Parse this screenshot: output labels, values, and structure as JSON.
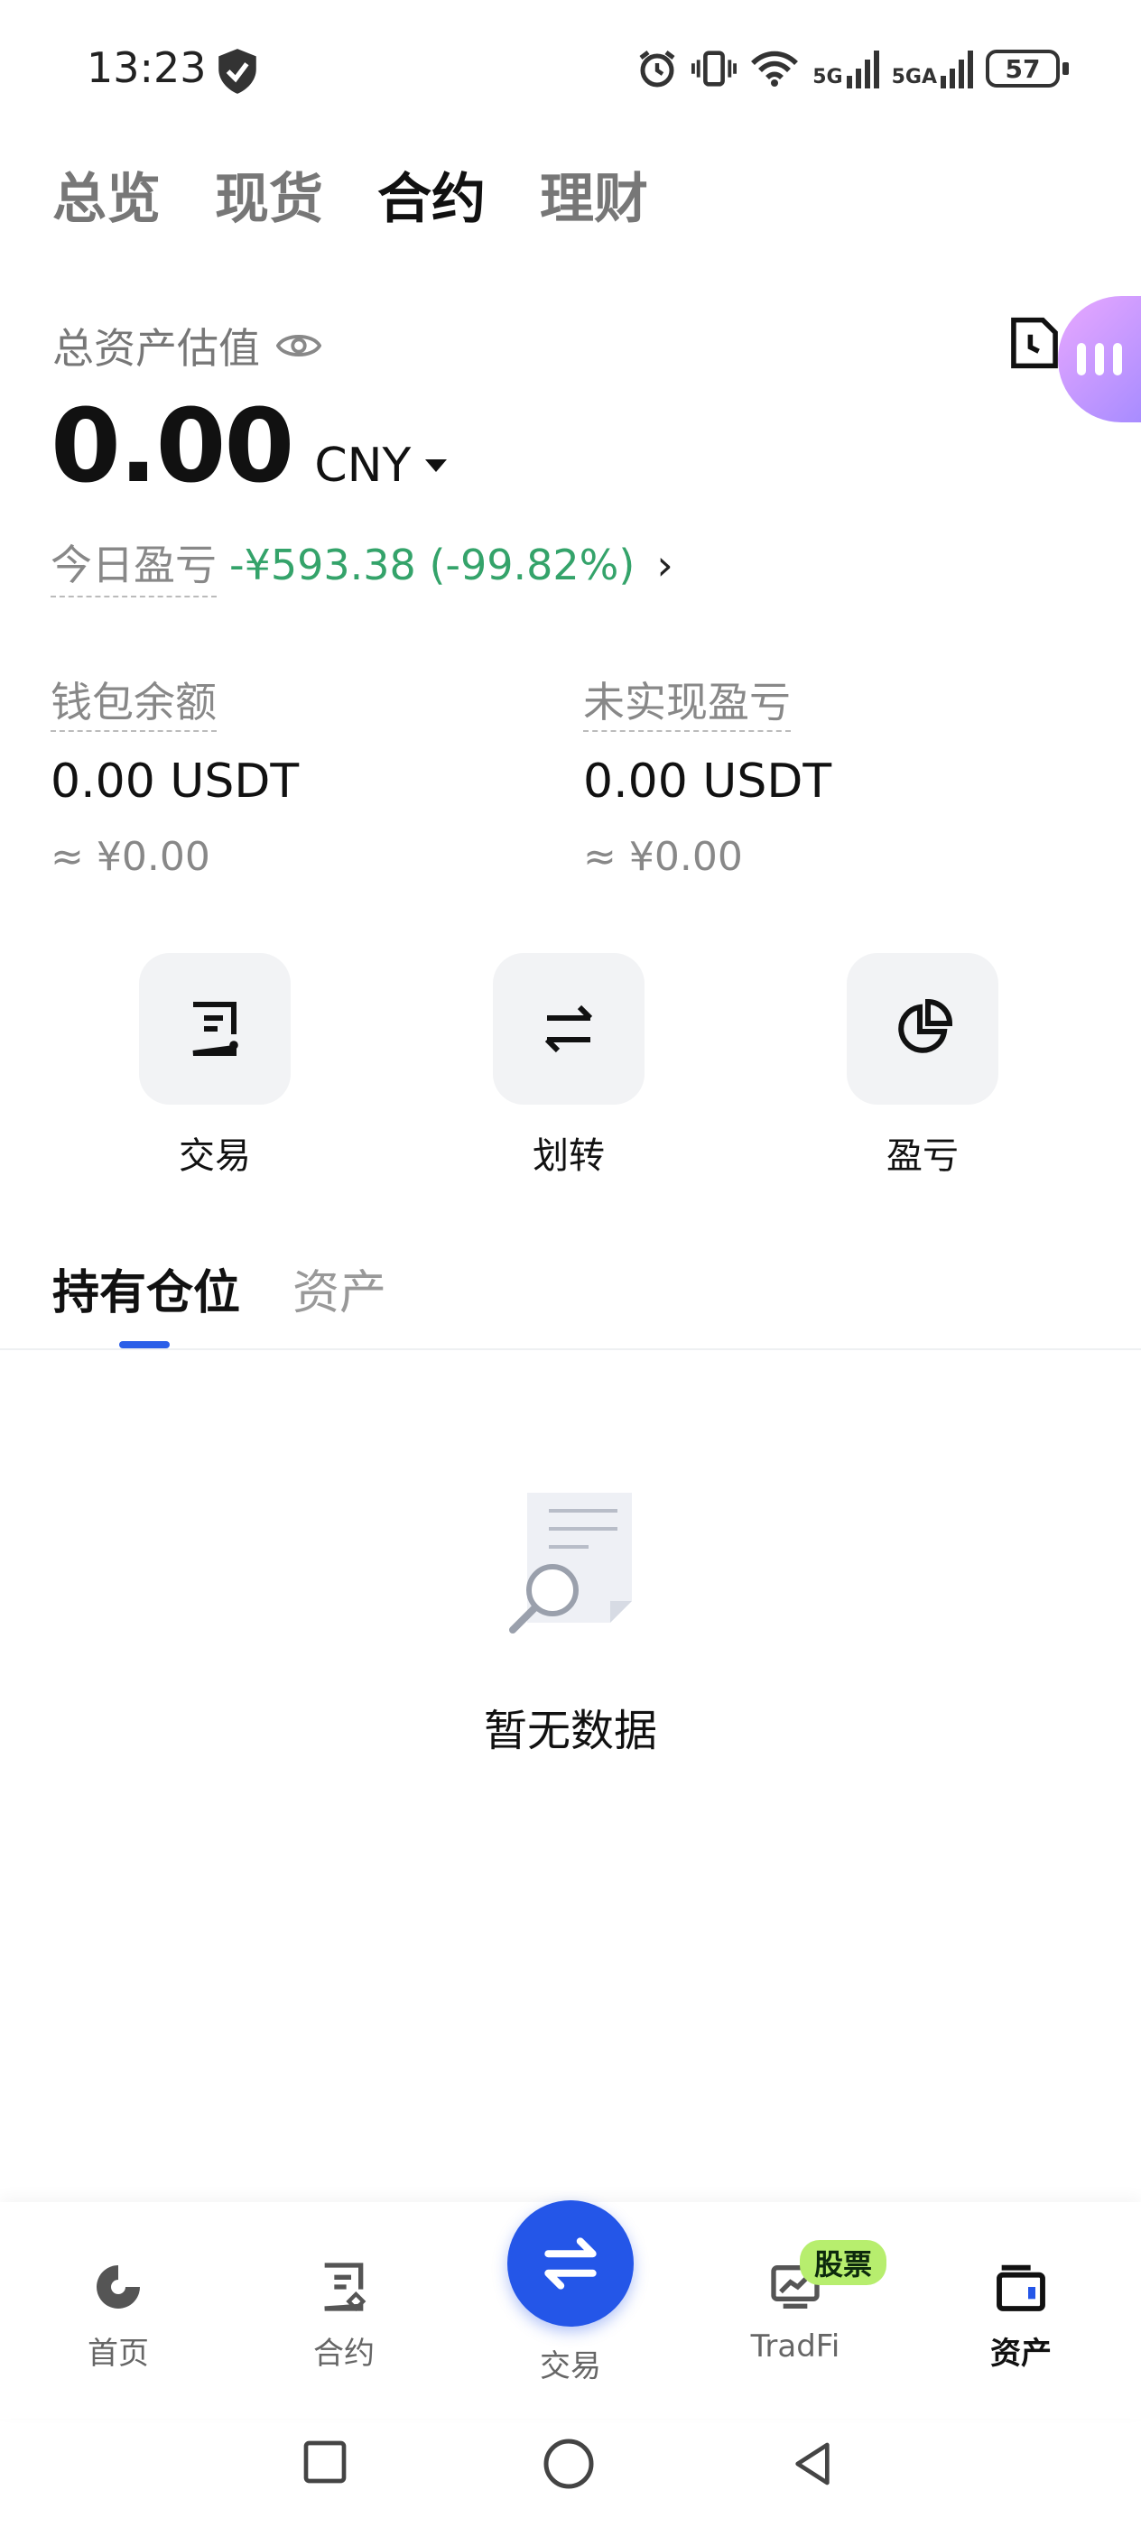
{
  "status_bar": {
    "time": "13:23",
    "net1": "5G",
    "net2": "5GA",
    "battery": "57"
  },
  "top_tabs": [
    "总览",
    "现货",
    "合约",
    "理财"
  ],
  "top_tab_active_index": 2,
  "overview": {
    "estimate_label": "总资产估值",
    "total_value": "0.00",
    "currency": "CNY",
    "today_pnl_label": "今日盈亏",
    "today_pnl_value": "-¥593.38 (-99.82%)"
  },
  "balances": [
    {
      "label": "钱包余额",
      "value": "0.00 USDT",
      "approx": "≈ ¥0.00"
    },
    {
      "label": "未实现盈亏",
      "value": "0.00 USDT",
      "approx": "≈ ¥0.00"
    }
  ],
  "actions": [
    {
      "label": "交易",
      "icon": "trade-doc-icon"
    },
    {
      "label": "划转",
      "icon": "transfer-icon"
    },
    {
      "label": "盈亏",
      "icon": "pie-chart-icon"
    }
  ],
  "sub_tabs": [
    "持有仓位",
    "资产"
  ],
  "empty_state": {
    "text": "暂无数据"
  },
  "bottom_nav": {
    "items": [
      {
        "label": "首页",
        "icon": "home-icon"
      },
      {
        "label": "合约",
        "icon": "contract-icon"
      },
      {
        "label": "交易",
        "icon": "swap-icon"
      },
      {
        "label": "TradFi",
        "icon": "tradfi-icon",
        "badge": "股票"
      },
      {
        "label": "资产",
        "icon": "wallet-icon"
      }
    ],
    "active_index": 4
  },
  "colors": {
    "accent": "#2456e8",
    "pnl_green": "#34a36a",
    "badge_green": "#b7ee6e"
  }
}
